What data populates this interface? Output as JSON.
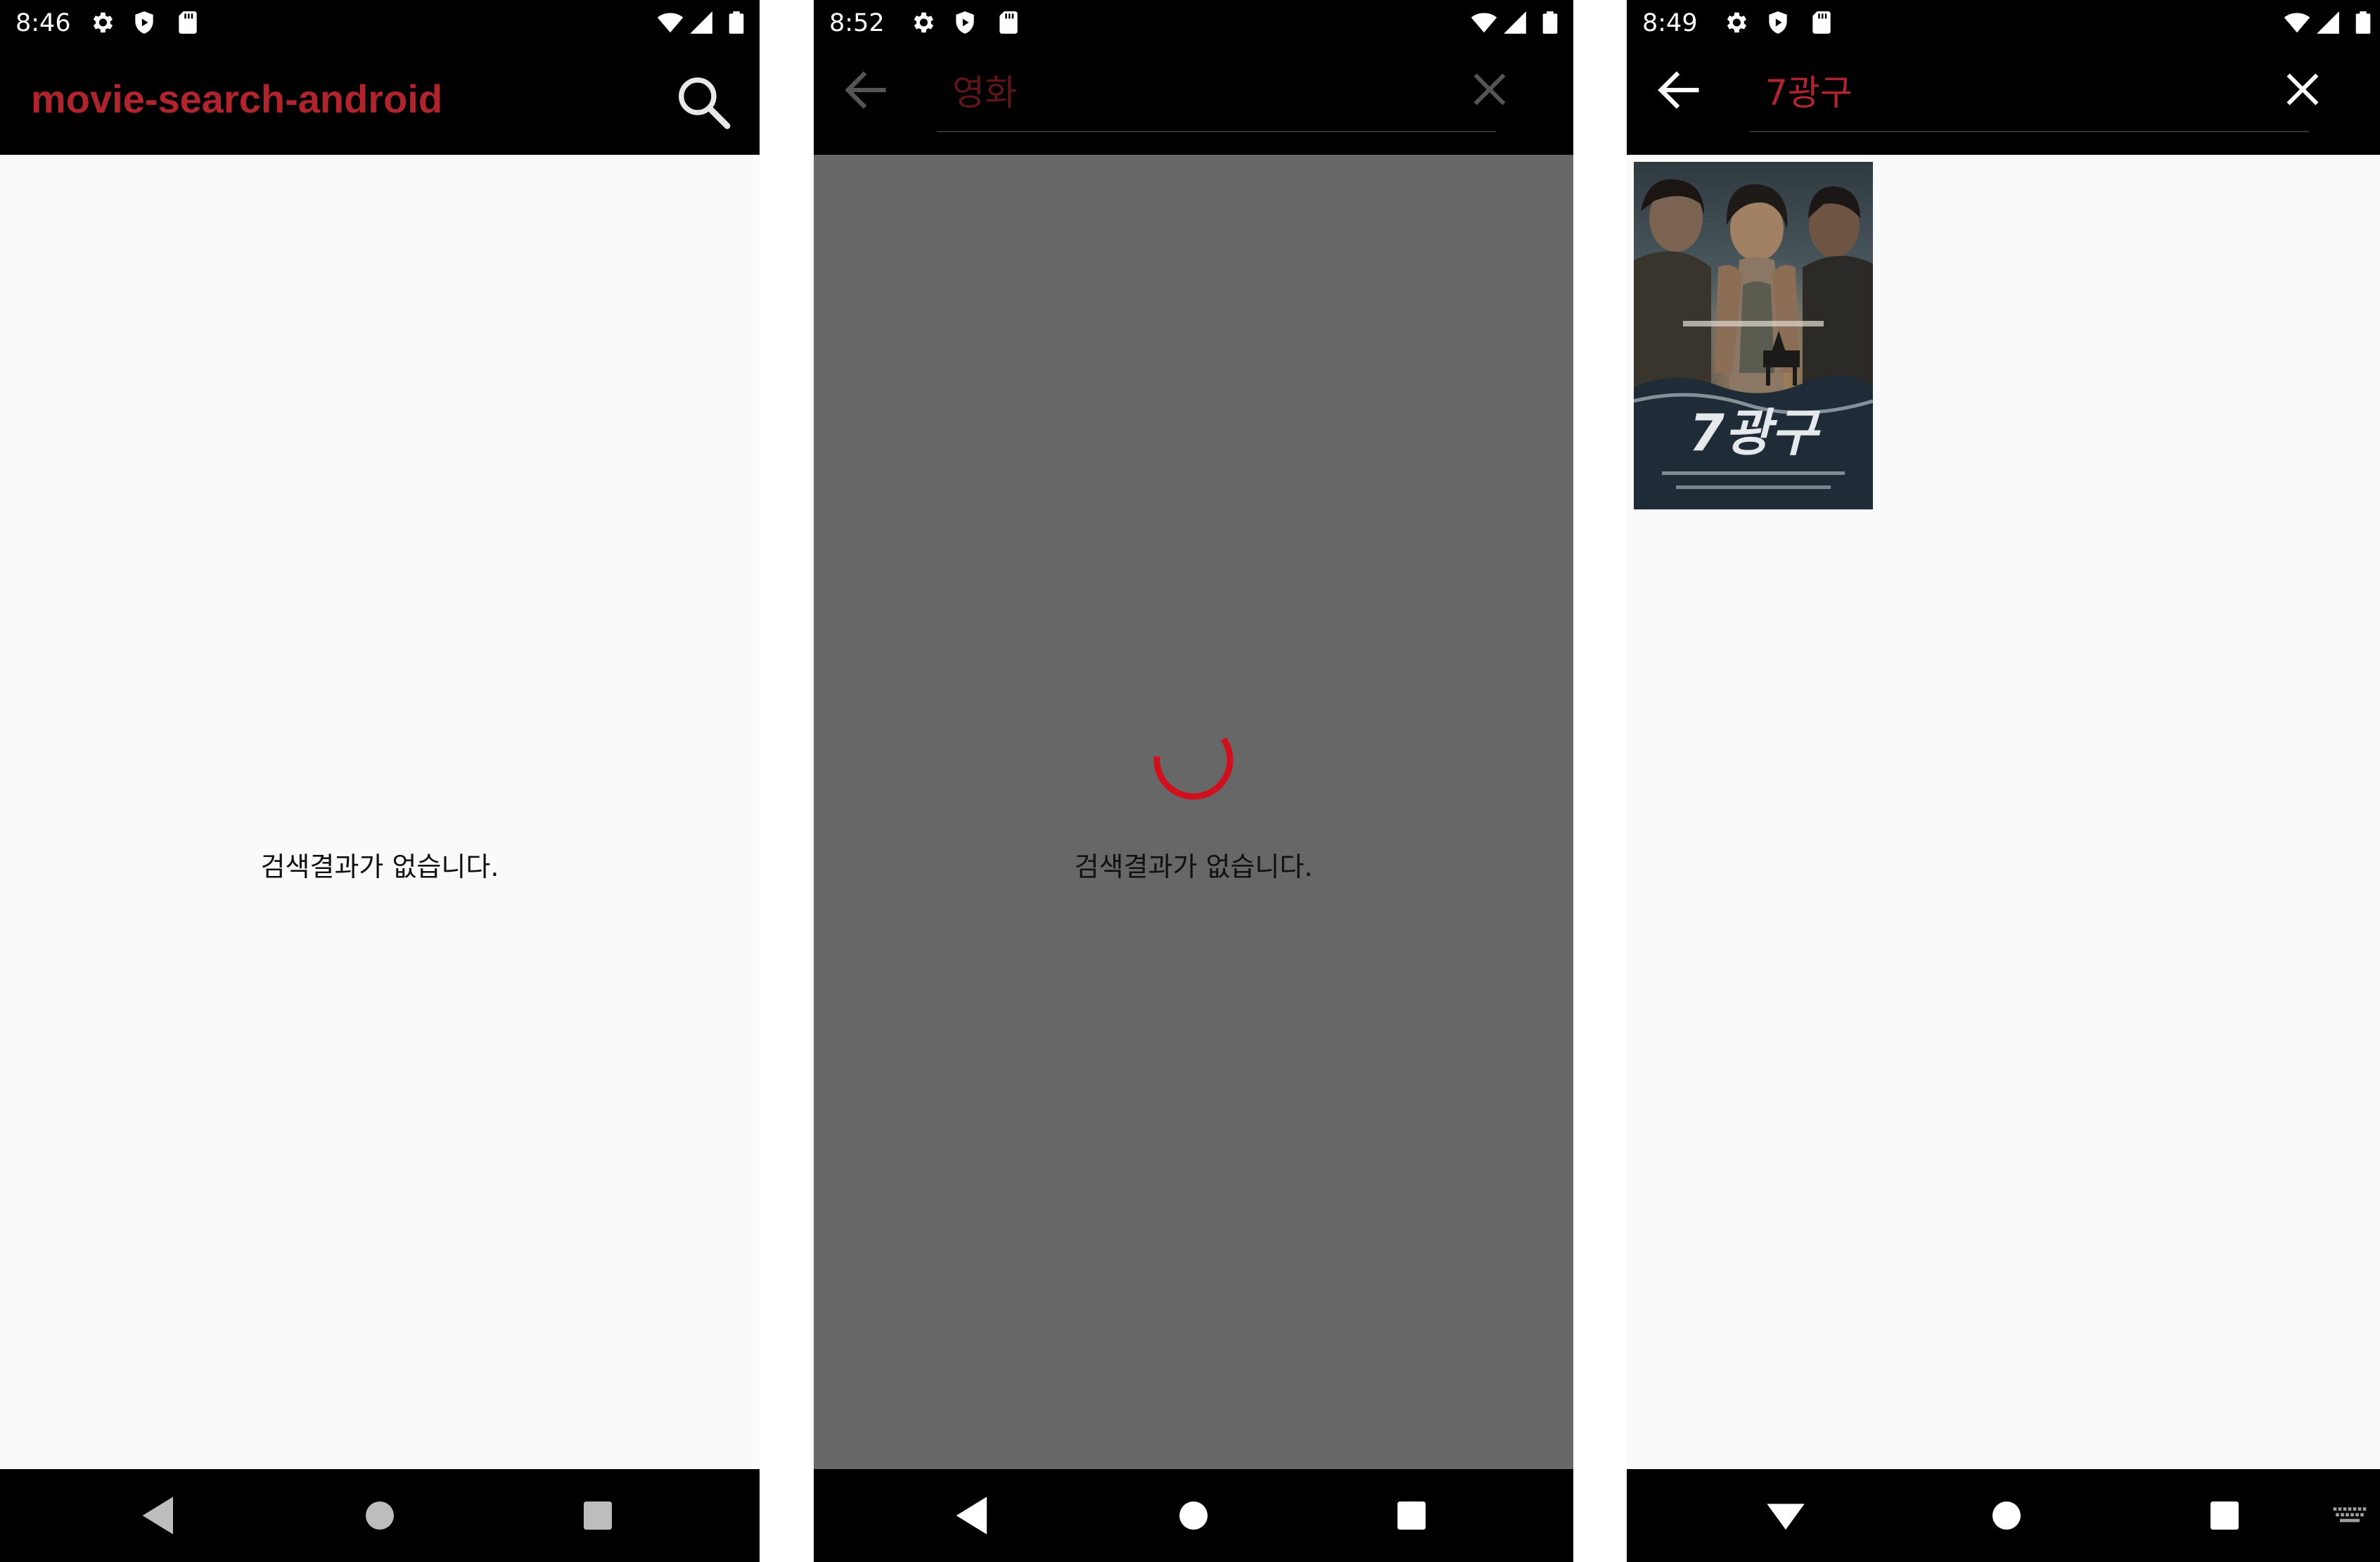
{
  "colors": {
    "status_bar": "#000000",
    "app_bar": "#000000",
    "accent": "#b0242d",
    "content_bg": "#fafafa",
    "dim_overlay": "#676767",
    "spinner": "#d0101c"
  },
  "screens": [
    {
      "status": {
        "time": "8:46",
        "icons": [
          "settings-icon",
          "shield-icon",
          "sd-card-icon",
          "wifi-icon",
          "signal-icon",
          "battery-icon"
        ]
      },
      "app_bar": {
        "title": "movie-search-android",
        "action_icon": "search-icon"
      },
      "content": {
        "message": "검색결과가 없습니다."
      },
      "nav": {
        "icons": [
          "back-icon",
          "home-icon",
          "recents-icon"
        ]
      }
    },
    {
      "status": {
        "time": "8:52",
        "icons": [
          "settings-icon",
          "shield-icon",
          "sd-card-icon",
          "wifi-icon",
          "signal-icon",
          "battery-icon"
        ]
      },
      "search": {
        "query": "영화",
        "back_icon": "arrow-left-icon",
        "clear_icon": "close-icon"
      },
      "content": {
        "loading": true,
        "message": "검색결과가 없습니다."
      },
      "nav": {
        "icons": [
          "back-icon",
          "home-icon",
          "recents-icon"
        ]
      }
    },
    {
      "status": {
        "time": "8:49",
        "icons": [
          "settings-icon",
          "shield-icon",
          "sd-card-icon",
          "wifi-icon",
          "signal-icon",
          "battery-icon"
        ]
      },
      "search": {
        "query": "7광구",
        "back_icon": "arrow-left-icon",
        "clear_icon": "close-icon"
      },
      "content": {
        "results": [
          {
            "poster_title": "7광구",
            "poster_tagline": "피할 수 없는 놈이 시작한 사투가 시작된다"
          }
        ]
      },
      "nav": {
        "icons": [
          "hide-keyboard-icon",
          "home-icon",
          "recents-icon",
          "keyboard-icon"
        ]
      }
    }
  ]
}
